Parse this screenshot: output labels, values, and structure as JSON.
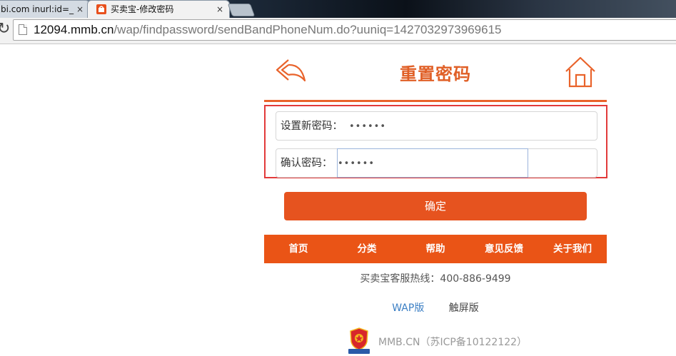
{
  "browser": {
    "tabs": [
      {
        "title": "bi.com inurl:id=_",
        "close": "×",
        "active": false
      },
      {
        "title": "买卖宝-修改密码",
        "close": "×",
        "active": true
      }
    ],
    "address": {
      "host": "12094.mmb.cn",
      "path": "/wap/findpassword/sendBandPhoneNum.do?uuniq=1427032973969615"
    },
    "reload_icon": "reload-icon"
  },
  "header": {
    "title": "重置密码",
    "back_icon": "back-arrow-icon",
    "home_icon": "home-icon",
    "accent_color": "#e9632b"
  },
  "form": {
    "new_password_label": "设置新密码：",
    "new_password_value": "••••••",
    "confirm_password_label": "确认密码：",
    "confirm_password_value": "••••••",
    "highlight_color": "#e23a3a"
  },
  "submit_label": "确定",
  "footer_nav": [
    "首页",
    "分类",
    "帮助",
    "意见反馈",
    "关于我们"
  ],
  "hotline": "买卖宝客服热线：400-886-9499",
  "versions": {
    "wap": "WAP版",
    "touch": "触屏版"
  },
  "icp": "MMB.CN（苏ICP备10122122）"
}
